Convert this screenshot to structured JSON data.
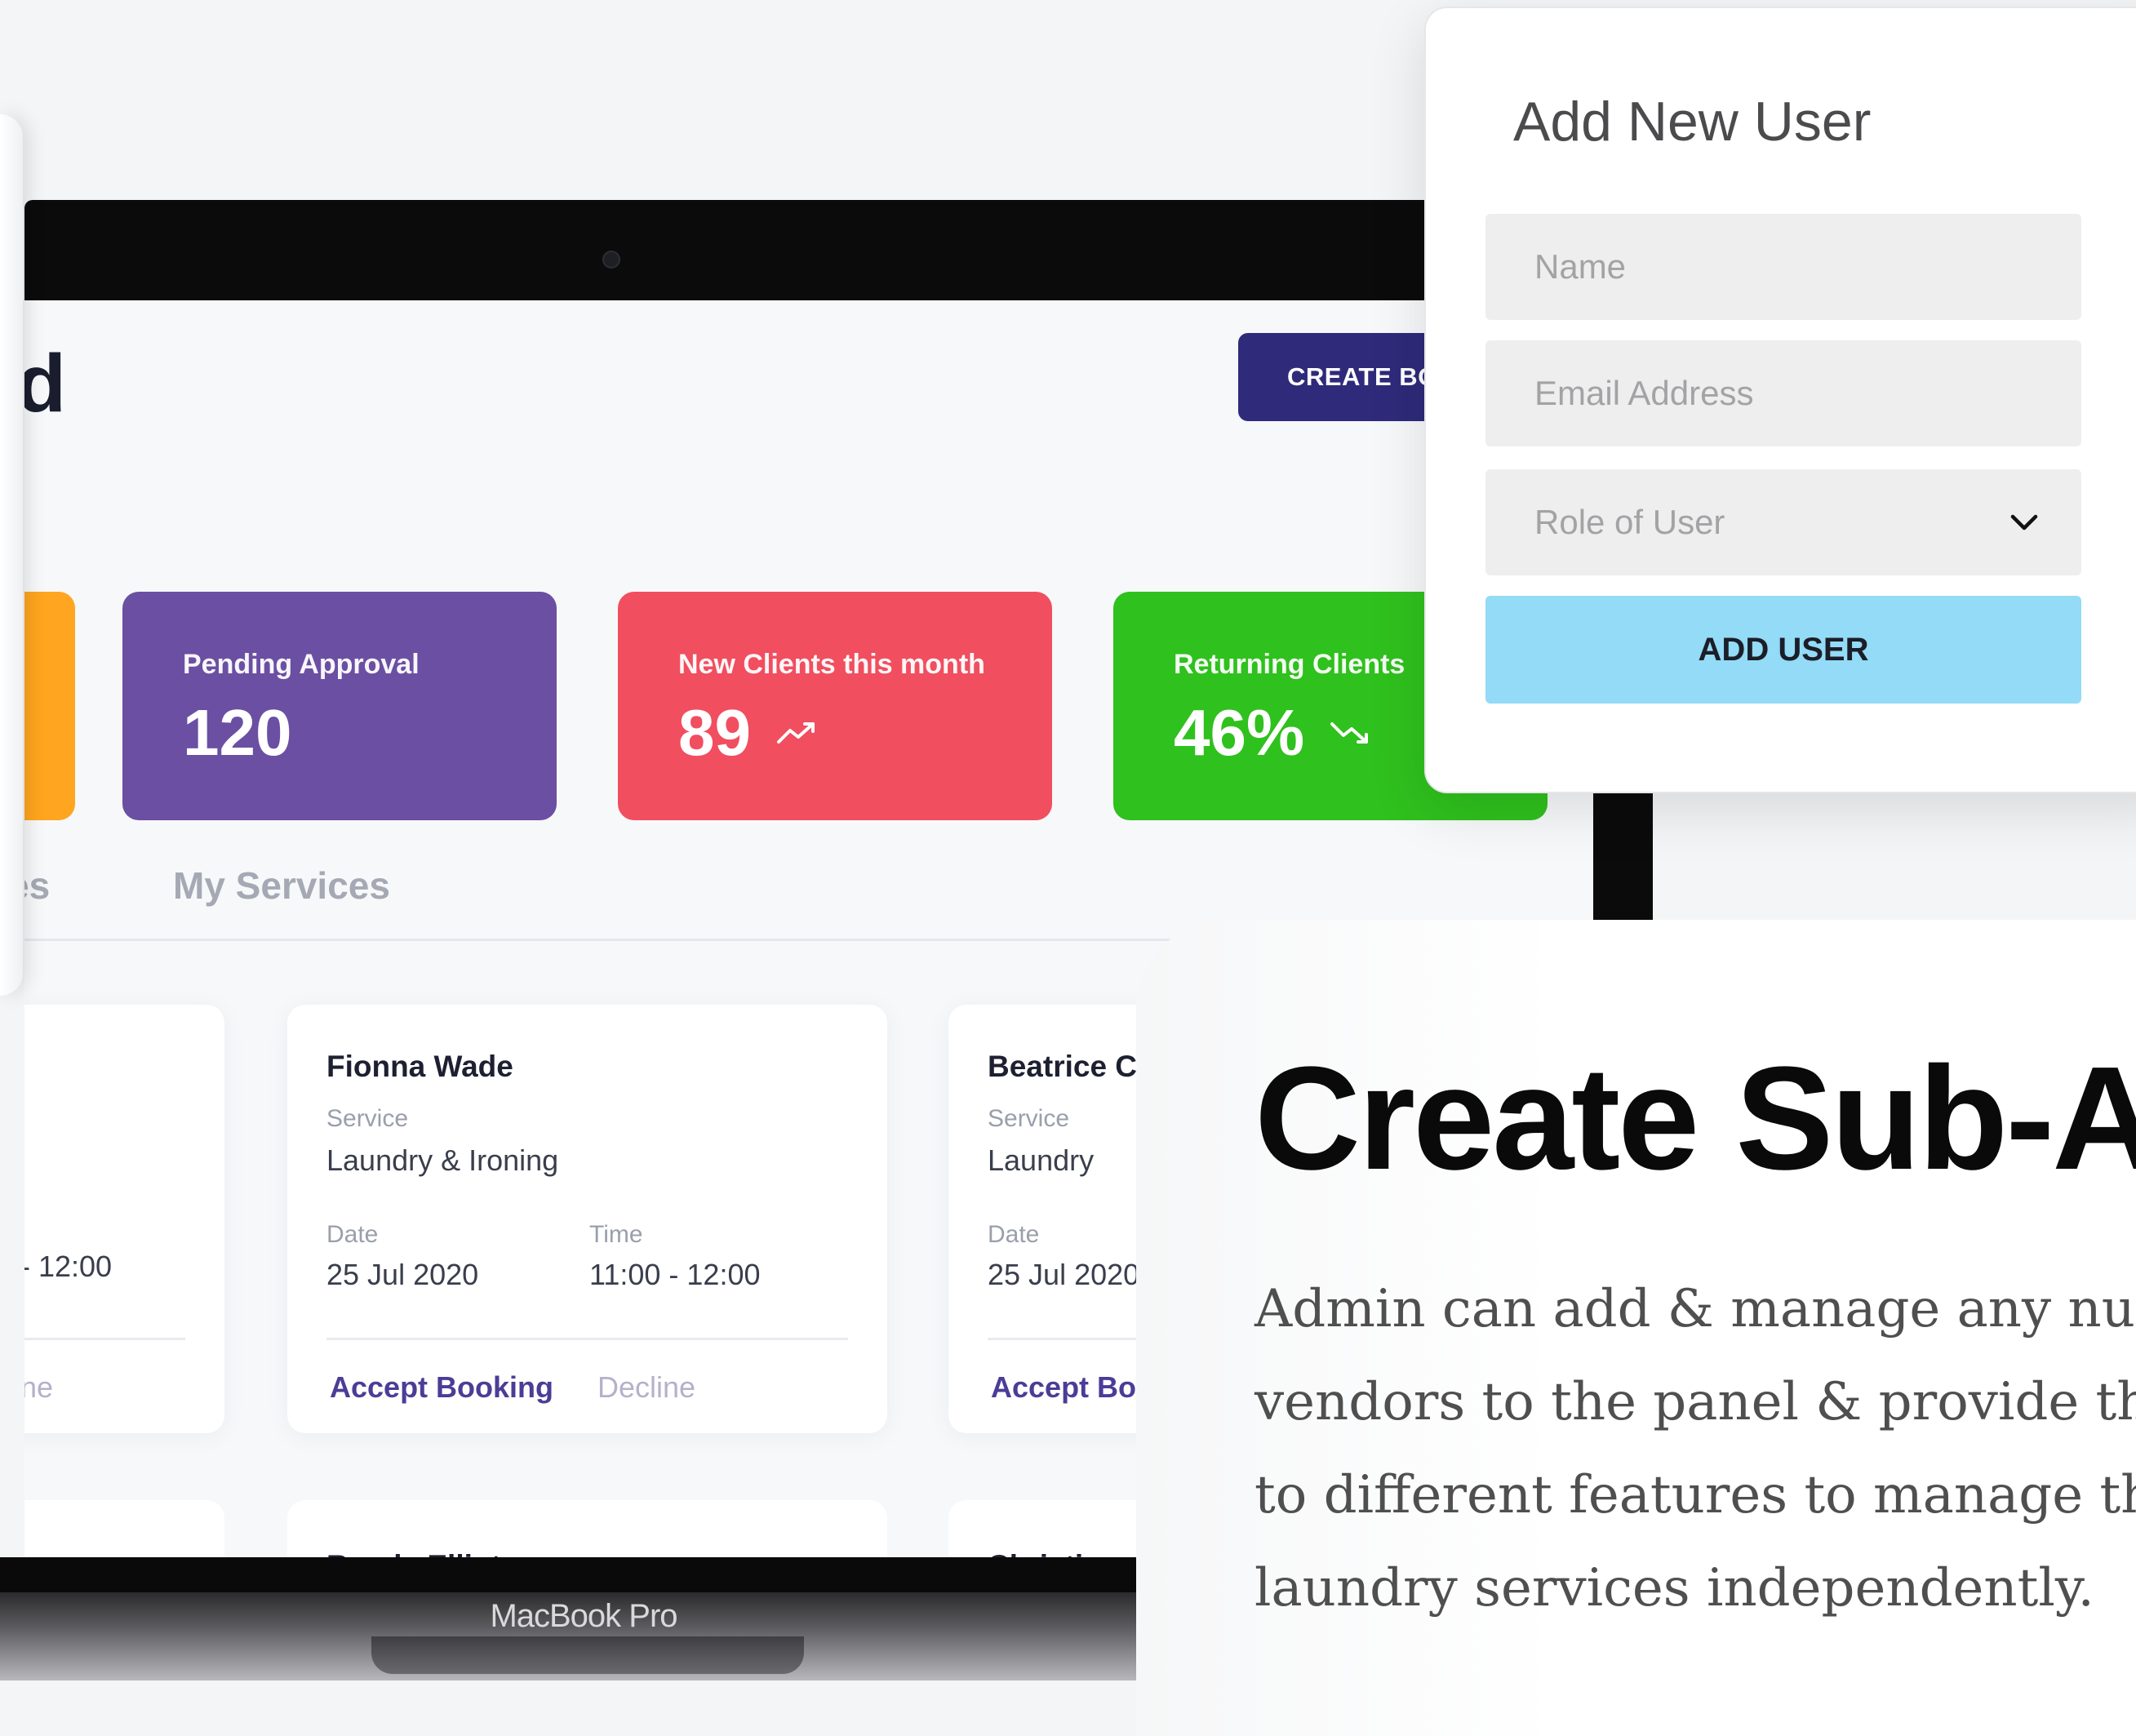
{
  "dashboard": {
    "title_fragment": "d",
    "create_booking_label": "CREATE BOOKING",
    "stats": [
      {
        "label": "",
        "value": ""
      },
      {
        "label": "Pending Approval",
        "value": "120"
      },
      {
        "label": "New Clients this month",
        "value": "89",
        "trend": "up"
      },
      {
        "label": "Returning Clients",
        "value": "46%",
        "trend": "down"
      }
    ],
    "tabs": [
      "es",
      "My Services"
    ],
    "bookings": [
      {
        "name": "",
        "service_label": "",
        "service": "",
        "date_label": "",
        "date": "",
        "time_label": "",
        "time": "- 12:00",
        "accept": "",
        "decline": "ne"
      },
      {
        "name": "Fionna Wade",
        "service_label": "Service",
        "service": "Laundry & Ironing",
        "date_label": "Date",
        "date": "25 Jul 2020",
        "time_label": "Time",
        "time": "11:00 - 12:00",
        "accept": "Accept Booking",
        "decline": "Decline"
      },
      {
        "name": "Beatrice C",
        "service_label": "Service",
        "service": "Laundry",
        "date_label": "Date",
        "date": "25 Jul 2020",
        "time_label": "",
        "time": "",
        "accept": "Accept Boo",
        "decline": ""
      }
    ],
    "next_bookings": [
      "Randy Elliot",
      "Christine"
    ]
  },
  "device": {
    "label": "MacBook Pro"
  },
  "add_user": {
    "title": "Add New User",
    "name_placeholder": "Name",
    "email_placeholder": "Email Address",
    "role_placeholder": "Role of User",
    "submit_label": "ADD USER"
  },
  "promo": {
    "title": "Create Sub-Ac",
    "body": "Admin can add & manage any nu\nvendors to the panel & provide the\nto different features to manage the\nlaundry services independently."
  },
  "colors": {
    "pending": "#6b4fa3",
    "new_clients": "#f14e60",
    "returning": "#2fc11d",
    "create_booking": "#2f2a7a",
    "add_user_button": "#93dbf6"
  }
}
